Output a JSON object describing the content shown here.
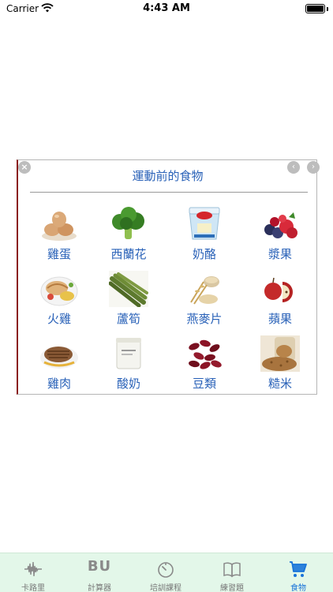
{
  "status": {
    "carrier": "Carrier",
    "time": "4:43 AM"
  },
  "card": {
    "title": "運動前的食物",
    "close_icon": "×",
    "prev_icon": "‹",
    "next_icon": "›",
    "foods": [
      {
        "label": "雞蛋",
        "icon": "egg-icon"
      },
      {
        "label": "西蘭花",
        "icon": "broccoli-icon"
      },
      {
        "label": "奶酪",
        "icon": "cheese-tub-icon"
      },
      {
        "label": "漿果",
        "icon": "berries-icon"
      },
      {
        "label": "火雞",
        "icon": "turkey-icon"
      },
      {
        "label": "蘆筍",
        "icon": "asparagus-icon"
      },
      {
        "label": "燕麥片",
        "icon": "oats-icon"
      },
      {
        "label": "蘋果",
        "icon": "apple-icon"
      },
      {
        "label": "雞肉",
        "icon": "chicken-icon"
      },
      {
        "label": "酸奶",
        "icon": "yogurt-icon"
      },
      {
        "label": "豆類",
        "icon": "beans-icon"
      },
      {
        "label": "糙米",
        "icon": "brown-rice-icon"
      }
    ]
  },
  "tabs": [
    {
      "label": "卡路里",
      "icon": "waveform-icon"
    },
    {
      "label": "計算器",
      "icon": "bu-icon",
      "icon_text": "BU"
    },
    {
      "label": "培訓課程",
      "icon": "timer-icon"
    },
    {
      "label": "練習題",
      "icon": "book-icon"
    },
    {
      "label": "食物",
      "icon": "cart-icon",
      "active": true
    }
  ],
  "colors": {
    "accent": "#1a74d9",
    "label_blue": "#2a62b8",
    "tab_bg": "#e3f7e9"
  }
}
